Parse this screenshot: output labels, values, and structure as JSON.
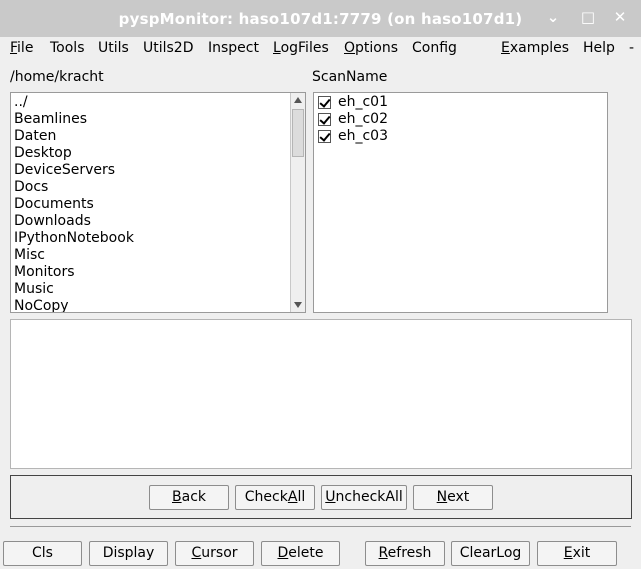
{
  "window": {
    "title": "pyspMonitor: haso107d1:7779 (on haso107d1)",
    "minimize_glyph": "⌄",
    "maximize_glyph": "□",
    "close_glyph": "✕"
  },
  "menubar": [
    {
      "pre": "",
      "ul": "F",
      "post": "ile"
    },
    {
      "pre": "Tools",
      "ul": "",
      "post": ""
    },
    {
      "pre": "Utils",
      "ul": "",
      "post": ""
    },
    {
      "pre": "Utils2D",
      "ul": "",
      "post": ""
    },
    {
      "pre": "Inspect",
      "ul": "",
      "post": ""
    },
    {
      "pre": "",
      "ul": "L",
      "post": "ogFiles"
    },
    {
      "pre": "",
      "ul": "O",
      "post": "ptions"
    },
    {
      "pre": "Config",
      "ul": "",
      "post": ""
    },
    {
      "pre": "",
      "ul": "E",
      "post": "xamples"
    },
    {
      "pre": "Help",
      "ul": "",
      "post": ""
    },
    {
      "pre": "-",
      "ul": "",
      "post": ""
    }
  ],
  "directory": {
    "path": "/home/kracht",
    "items": [
      "../",
      "Beamlines",
      "Daten",
      "Desktop",
      "DeviceServers",
      "Docs",
      "Documents",
      "Downloads",
      "IPythonNotebook",
      "Misc",
      "Monitors",
      "Music",
      "NoCopy"
    ]
  },
  "scans": {
    "header": "ScanName",
    "items": [
      {
        "label": "eh_c01",
        "checked": true
      },
      {
        "label": "eh_c02",
        "checked": true
      },
      {
        "label": "eh_c03",
        "checked": true
      }
    ]
  },
  "log": {
    "text": ""
  },
  "nav_buttons": [
    {
      "pre": "",
      "ul": "B",
      "post": "ack"
    },
    {
      "pre": "Check",
      "ul": "A",
      "post": "ll"
    },
    {
      "pre": "",
      "ul": "U",
      "post": "ncheckAll"
    },
    {
      "pre": "",
      "ul": "N",
      "post": "ext"
    }
  ],
  "bottom_buttons": [
    {
      "pre": "Cls",
      "ul": "",
      "post": ""
    },
    {
      "pre": "Display",
      "ul": "",
      "post": ""
    },
    {
      "pre": "",
      "ul": "C",
      "post": "ursor"
    },
    {
      "pre": "",
      "ul": "D",
      "post": "elete"
    },
    {
      "pre": "",
      "ul": "R",
      "post": "efresh"
    },
    {
      "pre": "ClearLog",
      "ul": "",
      "post": ""
    },
    {
      "pre": "",
      "ul": "E",
      "post": "xit"
    }
  ]
}
